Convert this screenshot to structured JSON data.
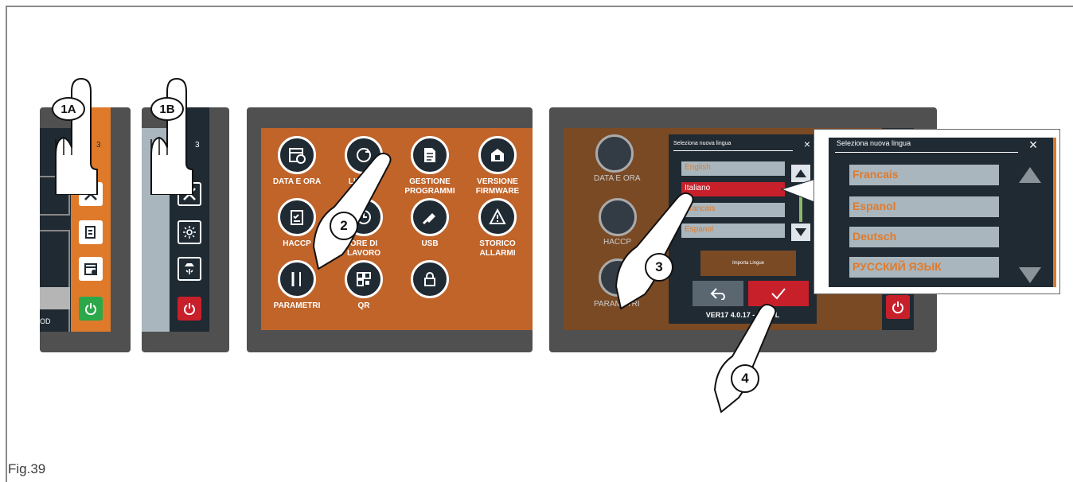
{
  "figure": {
    "caption": "Fig.39"
  },
  "steps": {
    "s1a": "1A",
    "s1b": "1B",
    "s2": "2",
    "s3": "3",
    "s4": "4"
  },
  "panel1": {
    "digit": "3",
    "label_od": "OD"
  },
  "panel2": {
    "digit": "3"
  },
  "menu": {
    "items": [
      {
        "label1": "DATA E ORA",
        "label2": "",
        "icon": "calendar-clock-icon"
      },
      {
        "label1": "LINGUA",
        "label2": "",
        "icon": "language-icon"
      },
      {
        "label1": "GESTIONE",
        "label2": "PROGRAMMI",
        "icon": "document-icon"
      },
      {
        "label1": "VERSIONE",
        "label2": "FIRMWARE",
        "icon": "firmware-icon"
      },
      {
        "label1": "HACCP",
        "label2": "",
        "icon": "clipboard-check-icon"
      },
      {
        "label1": "ORE DI",
        "label2": "LAVORO",
        "icon": "clock-icon"
      },
      {
        "label1": "USB",
        "label2": "",
        "icon": "usb-icon"
      },
      {
        "label1": "STORICO",
        "label2": "ALLARMI",
        "icon": "warning-icon"
      },
      {
        "label1": "PARAMETRI",
        "label2": "",
        "icon": "wrench-icon"
      },
      {
        "label1": "QR",
        "label2": "",
        "icon": "qr-icon"
      },
      {
        "label1": "",
        "label2": "",
        "icon": "lock-icon"
      }
    ]
  },
  "panel4": {
    "bg_labels": {
      "data_ora": "DATA E ORA",
      "haccp": "HACCP",
      "parametri": "PARAMETRI"
    },
    "dialog": {
      "title": "Seleziona nuova lingua",
      "close": "×",
      "options": [
        "English",
        "Italiano",
        "Francais",
        "Espanol"
      ],
      "selected_index": 1,
      "import_label": "Importa Lingue",
      "version": "VER17 4.0.17 - EN-ML"
    }
  },
  "zoom": {
    "title": "Seleziona nuova lingua",
    "close": "×",
    "options": [
      "Francais",
      "Espanol",
      "Deutsch",
      "РУССКИЙ ЯЗЫК"
    ]
  },
  "colors": {
    "orange": "#e07a2b",
    "dark": "#1f2a33",
    "panel": "#505050",
    "red": "#c8202b",
    "green": "#2ba84a"
  }
}
